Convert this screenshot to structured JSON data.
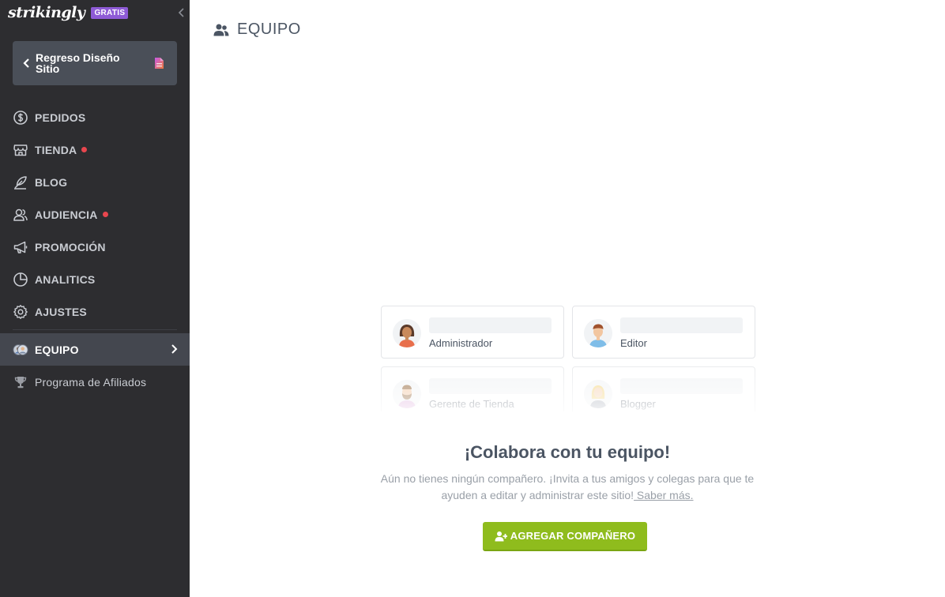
{
  "brand": {
    "logo_text": "strikingly",
    "badge": "GRATIS"
  },
  "sidebar": {
    "back_label": "Regreso Diseño Sitio",
    "items": [
      {
        "label": "PEDIDOS",
        "icon": "dollar-circle-icon",
        "dot": false
      },
      {
        "label": "TIENDA",
        "icon": "store-icon",
        "dot": true
      },
      {
        "label": "BLOG",
        "icon": "feather-icon",
        "dot": false
      },
      {
        "label": "AUDIENCIA",
        "icon": "audience-icon",
        "dot": true
      },
      {
        "label": "PROMOCIÓN",
        "icon": "megaphone-icon",
        "dot": false
      },
      {
        "label": "ANALITICS",
        "icon": "pie-chart-icon",
        "dot": false
      },
      {
        "label": "AJUSTES",
        "icon": "gear-icon",
        "dot": false
      }
    ],
    "active_item": {
      "label": "EQUIPO",
      "icon": "team-avatars-icon"
    },
    "affiliate_item": {
      "label": "Programa de Afiliados",
      "icon": "trophy-icon"
    }
  },
  "main": {
    "title": "EQUIPO",
    "roles": [
      {
        "label": "Administrador",
        "icon": "woman-avatar-icon"
      },
      {
        "label": "Editor",
        "icon": "man-avatar-icon"
      },
      {
        "label": "Gerente de Tienda",
        "icon": "bearded-man-avatar-icon"
      },
      {
        "label": "Blogger",
        "icon": "blonde-woman-avatar-icon"
      }
    ],
    "cta_title": "¡Colabora con tu equipo!",
    "cta_desc_line1": "Aún no tienes ningún compañero. ¡Invita a tus amigos y colegas para que te",
    "cta_desc_line2": "ayuden a editar y administrar este sitio!",
    "cta_link": " Saber más.",
    "cta_button": "AGREGAR COMPAÑERO"
  },
  "colors": {
    "sidebar_bg": "#2d2d30",
    "accent_green": "#8fbc1d",
    "badge_purple": "#8e5bd6",
    "notification_red": "#e8464e"
  }
}
